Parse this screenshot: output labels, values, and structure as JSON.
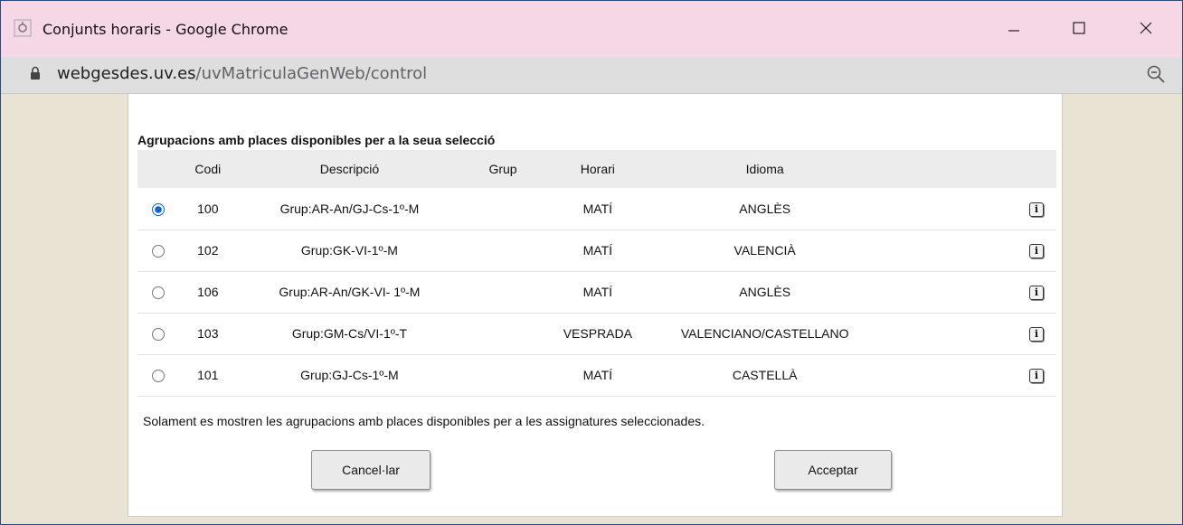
{
  "window": {
    "title": "Conjunts horaris - Google Chrome",
    "address_domain": "webgesdes.uv.es",
    "address_path": "/uvMatriculaGenWeb/control"
  },
  "panel": {
    "heading": "Agrupacions amb places disponibles per a la seua selecció",
    "columns": [
      "",
      "Codi",
      "Descripció",
      "Grup",
      "Horari",
      "Idioma",
      ""
    ],
    "rows": [
      {
        "selected": true,
        "codi": "100",
        "descripcio": "Grup:AR-An/GJ-Cs-1º-M",
        "grup": "",
        "horari": "MATÍ",
        "idioma": "ANGLÈS"
      },
      {
        "selected": false,
        "codi": "102",
        "descripcio": "Grup:GK-VI-1º-M",
        "grup": "",
        "horari": "MATÍ",
        "idioma": "VALENCIÀ"
      },
      {
        "selected": false,
        "codi": "106",
        "descripcio": "Grup:AR-An/GK-VI- 1º-M",
        "grup": "",
        "horari": "MATÍ",
        "idioma": "ANGLÈS"
      },
      {
        "selected": false,
        "codi": "103",
        "descripcio": "Grup:GM-Cs/VI-1º-T",
        "grup": "",
        "horari": "VESPRADA",
        "idioma": "VALENCIANO/CASTELLANO"
      },
      {
        "selected": false,
        "codi": "101",
        "descripcio": "Grup:GJ-Cs-1º-M",
        "grup": "",
        "horari": "MATÍ",
        "idioma": "CASTELLÀ"
      }
    ],
    "info_glyph": "i",
    "note": "Solament es mostren les agrupacions amb places disponibles per a les assignatures seleccionades.",
    "cancel_label": "Cancel·lar",
    "accept_label": "Acceptar"
  },
  "colors": {
    "titlebar": "#f6d7e6",
    "background": "#e8e3d2",
    "radio_selected": "#0a66d6"
  }
}
